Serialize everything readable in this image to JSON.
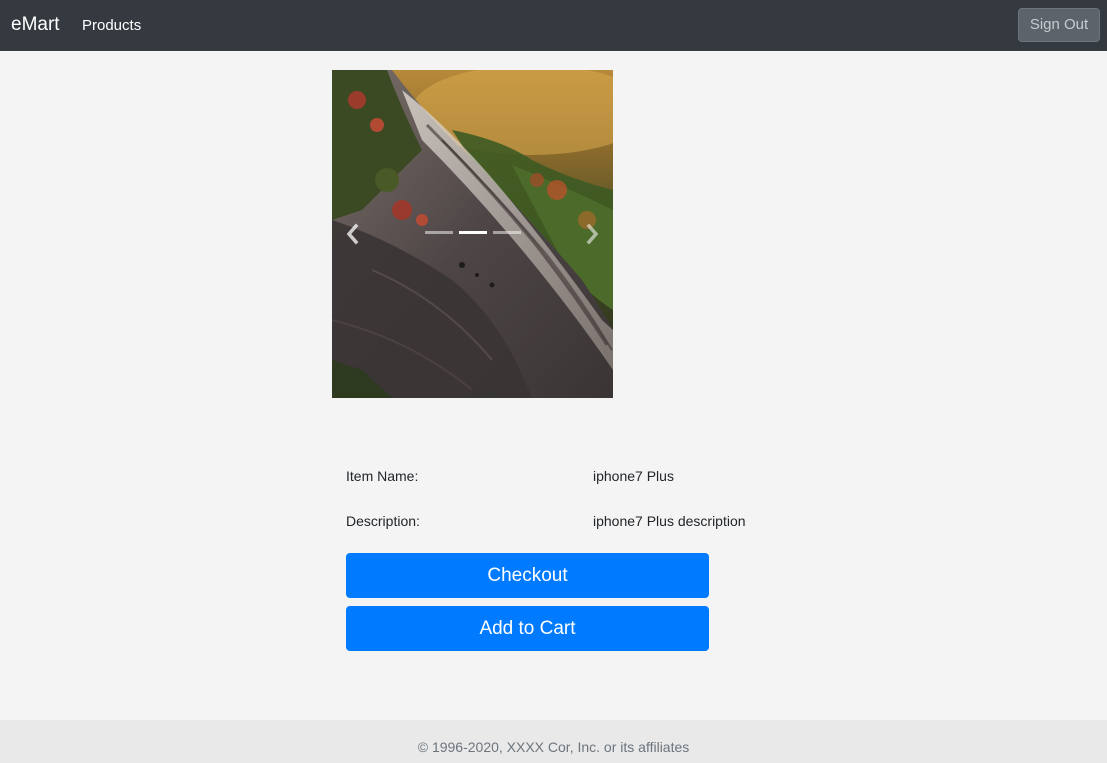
{
  "navbar": {
    "brand": "eMart",
    "links": [
      "Products"
    ],
    "sign_out_label": "Sign Out"
  },
  "carousel": {
    "slide_count": 3,
    "active_index": 1,
    "prev_icon": "chevron-left-icon",
    "next_icon": "chevron-right-icon"
  },
  "details": {
    "item_name_label": "Item Name:",
    "item_name_value": "iphone7 Plus",
    "description_label": "Description:",
    "description_value": "iphone7 Plus description"
  },
  "actions": {
    "checkout_label": "Checkout",
    "add_to_cart_label": "Add to Cart"
  },
  "footer": {
    "copyright": "© 1996-2020, XXXX Cor, Inc. or its affiliates"
  },
  "colors": {
    "navbar_bg": "#343a40",
    "primary": "#007bff",
    "page_bg": "#f4f4f4",
    "footer_bg": "#e9e9e9"
  }
}
